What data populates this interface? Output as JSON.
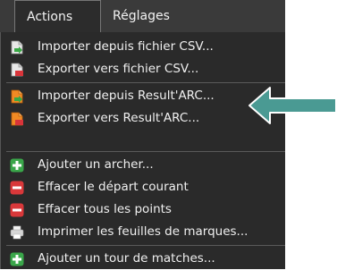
{
  "menubar": {
    "actions_label": "Actions",
    "settings_label": "Réglages"
  },
  "menu": {
    "items": [
      {
        "label": "Importer depuis fichier CSV...",
        "icon": "import-csv-icon"
      },
      {
        "label": "Exporter vers fichier CSV...",
        "icon": "export-csv-icon"
      },
      {
        "label": "Importer depuis Result'ARC...",
        "icon": "import-resultarc-icon"
      },
      {
        "label": "Exporter vers Result'ARC...",
        "icon": "export-resultarc-icon"
      },
      {
        "label": "Ajouter un archer...",
        "icon": "plus-icon"
      },
      {
        "label": "Effacer le départ courant",
        "icon": "minus-icon"
      },
      {
        "label": "Effacer tous les points",
        "icon": "minus-icon"
      },
      {
        "label": "Imprimer les feuilles de marques...",
        "icon": "printer-icon"
      },
      {
        "label": "Ajouter un tour de matches...",
        "icon": "plus-icon"
      }
    ]
  },
  "colors": {
    "menu_bg": "#2a2a2a",
    "menubar_bg": "#3a3a3a",
    "arrow": "#4a9a93",
    "plus_green": "#3aa64a",
    "minus_red": "#d9383a"
  }
}
